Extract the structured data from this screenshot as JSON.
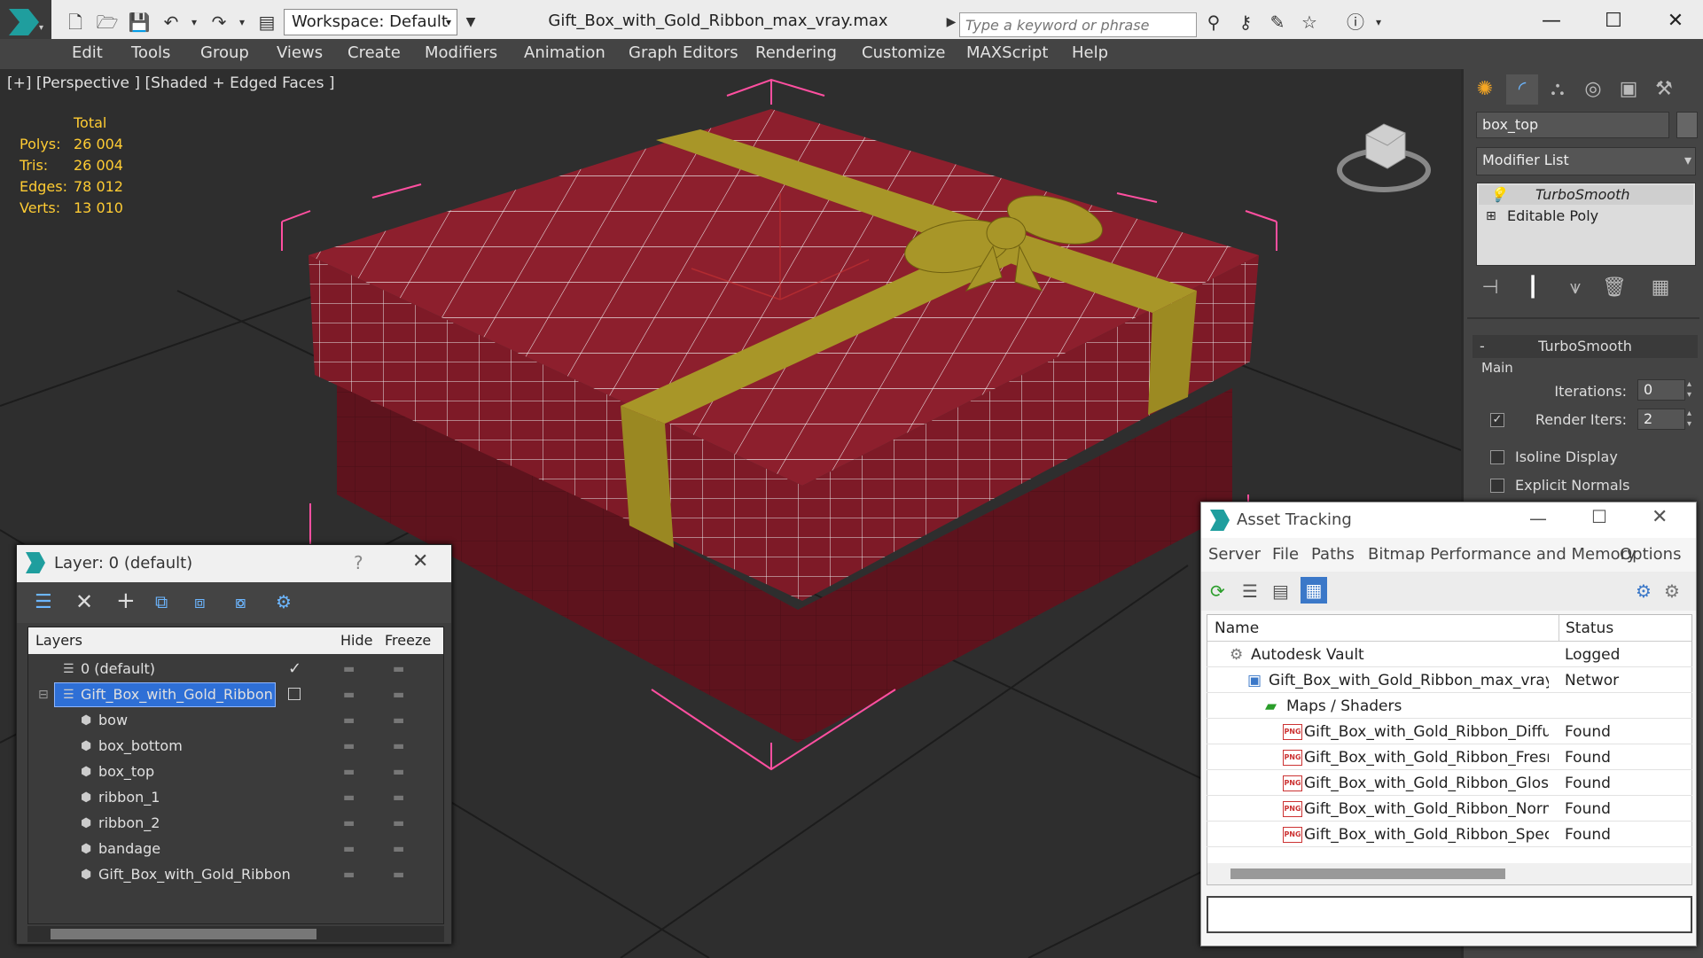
{
  "titlebar": {
    "workspace": "Workspace: Default",
    "doc_title": "Gift_Box_with_Gold_Ribbon_max_vray.max",
    "search_placeholder": "Type a keyword or phrase"
  },
  "menubar": {
    "items": [
      "Edit",
      "Tools",
      "Group",
      "Views",
      "Create",
      "Modifiers",
      "Animation",
      "Graph Editors",
      "Rendering",
      "Customize",
      "MAXScript",
      "Help"
    ]
  },
  "viewport": {
    "label": "[+] [Perspective ] [Shaded + Edged Faces ]",
    "stats": {
      "header": "Total",
      "rows": [
        {
          "label": "Polys:",
          "value": "26 004"
        },
        {
          "label": "Tris:",
          "value": "26 004"
        },
        {
          "label": "Edges:",
          "value": "78 012"
        },
        {
          "label": "Verts:",
          "value": "13 010"
        }
      ]
    },
    "colors": {
      "box": "#8a1f2c",
      "ribbon": "#a39326",
      "wire": "#ffffff",
      "bbox": "#ff4fa0"
    }
  },
  "cmdpanel": {
    "object_name": "box_top",
    "modifier_list": "Modifier List",
    "stack": [
      "TurboSmooth",
      "Editable Poly"
    ],
    "rollout_title": "TurboSmooth",
    "group_main": "Main",
    "iterations_label": "Iterations:",
    "iterations_value": "0",
    "render_iters_label": "Render Iters:",
    "render_iters_value": "2",
    "isoline_label": "Isoline Display",
    "explicit_normals_label": "Explicit Normals"
  },
  "layer_dialog": {
    "title": "Layer: 0 (default)",
    "help": "?",
    "columns": {
      "layers": "Layers",
      "hide": "Hide",
      "freeze": "Freeze"
    },
    "rows": [
      {
        "name": "0 (default)",
        "indent": 0,
        "kind": "layer"
      },
      {
        "name": "Gift_Box_with_Gold_Ribbon",
        "indent": 0,
        "kind": "layer",
        "selected": true
      },
      {
        "name": "bow",
        "indent": 1,
        "kind": "object"
      },
      {
        "name": "box_bottom",
        "indent": 1,
        "kind": "object"
      },
      {
        "name": "box_top",
        "indent": 1,
        "kind": "object"
      },
      {
        "name": "ribbon_1",
        "indent": 1,
        "kind": "object"
      },
      {
        "name": "ribbon_2",
        "indent": 1,
        "kind": "object"
      },
      {
        "name": "bandage",
        "indent": 1,
        "kind": "object"
      },
      {
        "name": "Gift_Box_with_Gold_Ribbon",
        "indent": 1,
        "kind": "object"
      }
    ]
  },
  "asset_dialog": {
    "title": "Asset Tracking",
    "menu": [
      "Server",
      "File",
      "Paths",
      "Bitmap Performance and Memory",
      "Options"
    ],
    "columns": {
      "name": "Name",
      "status": "Status"
    },
    "rows": [
      {
        "name": "Autodesk Vault",
        "status": "Logged",
        "level": 1,
        "icon": "vault"
      },
      {
        "name": "Gift_Box_with_Gold_Ribbon_max_vray.max",
        "status": "Networ",
        "level": 2,
        "icon": "max"
      },
      {
        "name": "Maps / Shaders",
        "status": "",
        "level": 3,
        "icon": "folder"
      },
      {
        "name": "Gift_Box_with_Gold_Ribbon_Diffuse.png",
        "status": "Found",
        "level": 4,
        "icon": "png"
      },
      {
        "name": "Gift_Box_with_Gold_Ribbon_Fresnel.png",
        "status": "Found",
        "level": 4,
        "icon": "png"
      },
      {
        "name": "Gift_Box_with_Gold_Ribbon_Glossiness.png",
        "status": "Found",
        "level": 4,
        "icon": "png"
      },
      {
        "name": "Gift_Box_with_Gold_Ribbon_Normal.png",
        "status": "Found",
        "level": 4,
        "icon": "png"
      },
      {
        "name": "Gift_Box_with_Gold_Ribbon_Specular.png",
        "status": "Found",
        "level": 4,
        "icon": "png"
      }
    ],
    "png_tag": "PNG"
  }
}
